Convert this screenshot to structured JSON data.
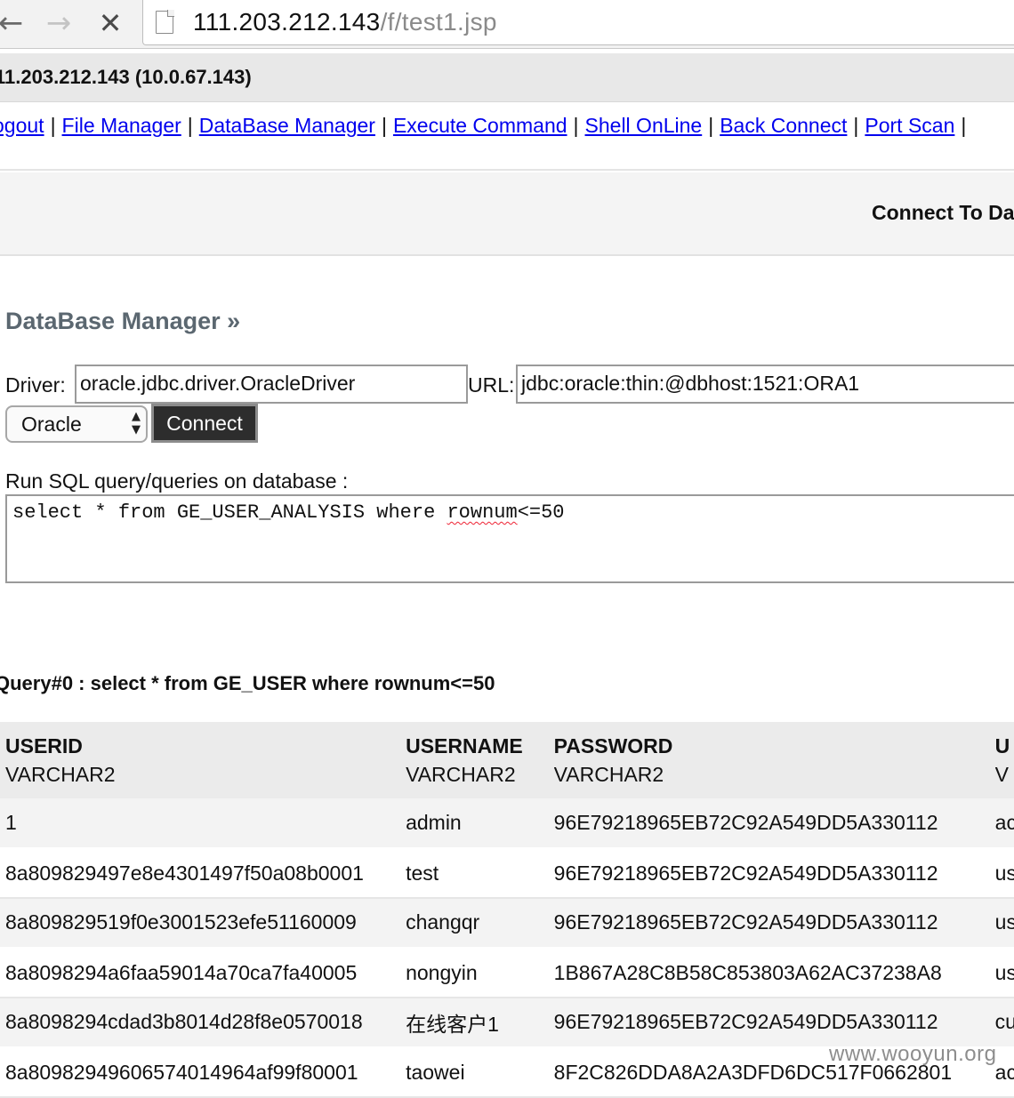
{
  "browser": {
    "back_icon": "←",
    "forward_icon": "→",
    "stop_icon": "✕",
    "url_host": "111.203.212.143",
    "url_path": "/f/test1.jsp"
  },
  "header": {
    "host": "11.203.212.143 (10.0.67.143)"
  },
  "menu": {
    "items": [
      "ogout",
      "File Manager",
      "DataBase Manager",
      "Execute Command",
      "Shell OnLine",
      "Back Connect",
      "Port Scan",
      ""
    ],
    "separator": "|"
  },
  "connect_panel": {
    "title": "Connect To Da"
  },
  "db_manager": {
    "title": "DataBase Manager »",
    "driver_label": "Driver:",
    "driver_value": "oracle.jdbc.driver.OracleDriver",
    "url_label": "URL:",
    "url_value": "jdbc:oracle:thin:@dbhost:1521:ORA1",
    "db_type_selected": "Oracle",
    "connect_label": "Connect",
    "sql_label": "Run SQL query/queries on database :",
    "sql_before": "select * from GE_USER_ANALYSIS where ",
    "sql_misspelled": "rownum",
    "sql_after": "<=50"
  },
  "query_result": {
    "title": "Query#0 : select * from GE_USER where rownum<=50",
    "columns": [
      {
        "name": "USERID",
        "type": "VARCHAR2"
      },
      {
        "name": "USERNAME",
        "type": "VARCHAR2"
      },
      {
        "name": "PASSWORD",
        "type": "VARCHAR2"
      },
      {
        "name": "U",
        "type": "V"
      }
    ],
    "rows": [
      [
        "1",
        "admin",
        "96E79218965EB72C92A549DD5A330112",
        "ac"
      ],
      [
        "8a809829497e8e4301497f50a08b0001",
        "test",
        "96E79218965EB72C92A549DD5A330112",
        "us"
      ],
      [
        "8a809829519f0e3001523efe51160009",
        "changqr",
        "96E79218965EB72C92A549DD5A330112",
        "us"
      ],
      [
        "8a8098294a6faa59014a70ca7fa40005",
        "nongyin",
        "1B867A28C8B58C853803A62AC37238A8",
        "us"
      ],
      [
        "8a8098294cdad3b8014d28f8e0570018",
        "在线客户1",
        "96E79218965EB72C92A549DD5A330112",
        "cu"
      ],
      [
        "8a80982949606574014964af99f80001",
        "taowei",
        "8F2C826DDA8A2A3DFD6DC517F0662801",
        "ac"
      ]
    ]
  },
  "watermark": "www.wooyun.org"
}
